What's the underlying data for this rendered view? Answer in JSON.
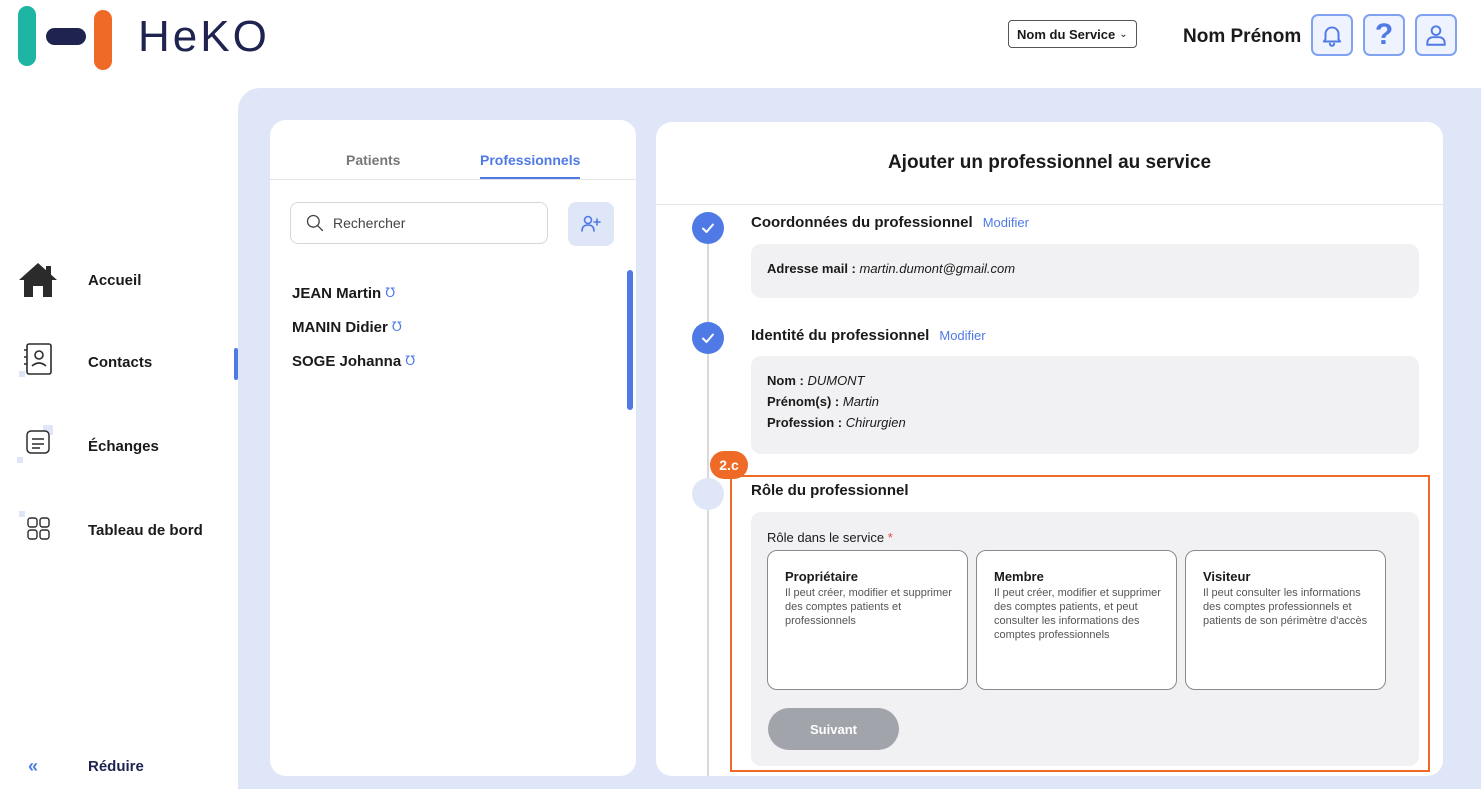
{
  "brand": {
    "name": "HeKO",
    "colors": {
      "teal": "#1fb5a5",
      "navy": "#1f2350",
      "orange": "#ef6a26",
      "accent": "#4f7ae6"
    }
  },
  "header": {
    "service_select": "Nom du Service",
    "user_name": "Nom Prénom",
    "help_label": "?",
    "icons": [
      "bell-icon",
      "help-icon",
      "user-icon"
    ]
  },
  "nav": {
    "items": [
      {
        "label": "Accueil",
        "icon": "home-icon"
      },
      {
        "label": "Contacts",
        "icon": "contacts-icon"
      },
      {
        "label": "Échanges",
        "icon": "messages-icon"
      },
      {
        "label": "Tableau de bord",
        "icon": "dashboard-icon"
      }
    ],
    "collapse_label": "Réduire",
    "collapse_glyph": "«",
    "active": "Contacts"
  },
  "contacts_panel": {
    "tabs": [
      {
        "label": "Patients"
      },
      {
        "label": "Professionnels"
      }
    ],
    "active_tab": "Professionnels",
    "search_placeholder": "Rechercher",
    "list": [
      {
        "name": "JEAN Martin"
      },
      {
        "name": "MANIN Didier"
      },
      {
        "name": "SOGE Johanna"
      }
    ]
  },
  "form": {
    "title": "Ajouter un professionnel au service",
    "steps": {
      "contact": {
        "title": "Coordonnées du professionnel",
        "edit": "Modifier",
        "email_label": "Adresse mail :",
        "email_value": "martin.dumont@gmail.com"
      },
      "identity": {
        "title": "Identité du professionnel",
        "edit": "Modifier",
        "nom_label": "Nom :",
        "nom_value": "DUMONT",
        "prenom_label": "Prénom(s) :",
        "prenom_value": "Martin",
        "profession_label": "Profession :",
        "profession_value": "Chirurgien"
      },
      "role": {
        "title": "Rôle du professionnel",
        "field_label": "Rôle dans le service",
        "required_mark": "*",
        "options": [
          {
            "title": "Propriétaire",
            "desc": "Il peut créer, modifier et supprimer des comptes patients et professionnels"
          },
          {
            "title": "Membre",
            "desc": "Il peut créer, modifier et supprimer des comptes patients, et peut consulter les informations des comptes professionnels"
          },
          {
            "title": "Visiteur",
            "desc": "Il peut consulter les informations des comptes professionnels et patients de son périmètre d'accès"
          }
        ],
        "next_label": "Suivant"
      }
    }
  },
  "annotation": {
    "badge": "2.c"
  }
}
